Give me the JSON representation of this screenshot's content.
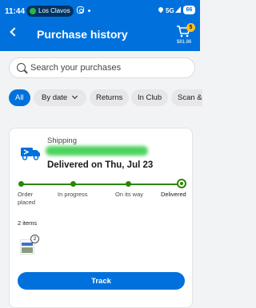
{
  "status_bar": {
    "time": "11:44",
    "location_pill": "Los Clavos",
    "network": "5G",
    "battery": "66"
  },
  "header": {
    "title": "Purchase history",
    "cart_count": "5",
    "cart_total": "$81.86"
  },
  "search": {
    "placeholder": "Search your purchases"
  },
  "filters": [
    {
      "label": "All",
      "active": true
    },
    {
      "label": "By date",
      "active": false,
      "dropdown": true
    },
    {
      "label": "Returns",
      "active": false
    },
    {
      "label": "In Club",
      "active": false
    },
    {
      "label": "Scan &",
      "active": false
    }
  ],
  "order": {
    "shipping_label": "Shipping",
    "status_title": "Delivered on Thu, Jul 23",
    "steps": [
      "Order placed",
      "In progress",
      "On its way",
      "Delivered"
    ],
    "items_count": "2 items",
    "item_quantity": "2",
    "track_label": "Track"
  },
  "colors": {
    "brand_blue": "#0071dc",
    "progress_green": "#2a8703",
    "cart_badge": "#ffc220"
  }
}
